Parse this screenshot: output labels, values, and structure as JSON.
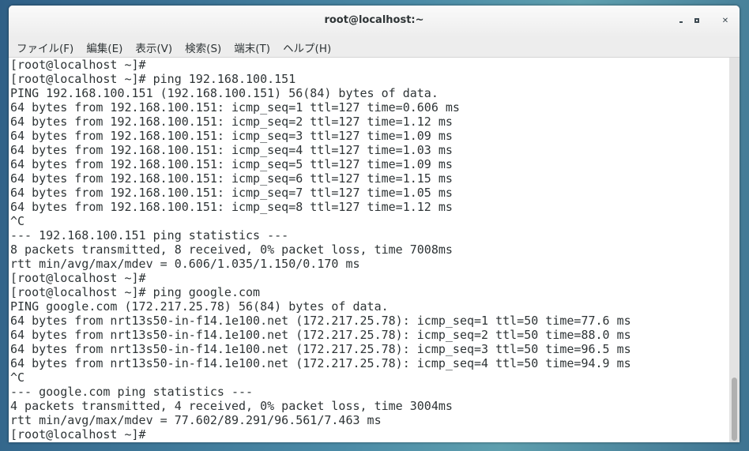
{
  "window": {
    "title": "root@localhost:~"
  },
  "menu": [
    "ファイル(F)",
    "編集(E)",
    "表示(V)",
    "検索(S)",
    "端末(T)",
    "ヘルプ(H)"
  ],
  "terminal_lines": [
    "[root@localhost ~]#",
    "[root@localhost ~]# ping 192.168.100.151",
    "PING 192.168.100.151 (192.168.100.151) 56(84) bytes of data.",
    "64 bytes from 192.168.100.151: icmp_seq=1 ttl=127 time=0.606 ms",
    "64 bytes from 192.168.100.151: icmp_seq=2 ttl=127 time=1.12 ms",
    "64 bytes from 192.168.100.151: icmp_seq=3 ttl=127 time=1.09 ms",
    "64 bytes from 192.168.100.151: icmp_seq=4 ttl=127 time=1.03 ms",
    "64 bytes from 192.168.100.151: icmp_seq=5 ttl=127 time=1.09 ms",
    "64 bytes from 192.168.100.151: icmp_seq=6 ttl=127 time=1.15 ms",
    "64 bytes from 192.168.100.151: icmp_seq=7 ttl=127 time=1.05 ms",
    "64 bytes from 192.168.100.151: icmp_seq=8 ttl=127 time=1.12 ms",
    "^C",
    "--- 192.168.100.151 ping statistics ---",
    "8 packets transmitted, 8 received, 0% packet loss, time 7008ms",
    "rtt min/avg/max/mdev = 0.606/1.035/1.150/0.170 ms",
    "[root@localhost ~]#",
    "[root@localhost ~]# ping google.com",
    "PING google.com (172.217.25.78) 56(84) bytes of data.",
    "64 bytes from nrt13s50-in-f14.1e100.net (172.217.25.78): icmp_seq=1 ttl=50 time=77.6 ms",
    "64 bytes from nrt13s50-in-f14.1e100.net (172.217.25.78): icmp_seq=2 ttl=50 time=88.0 ms",
    "64 bytes from nrt13s50-in-f14.1e100.net (172.217.25.78): icmp_seq=3 ttl=50 time=96.5 ms",
    "64 bytes from nrt13s50-in-f14.1e100.net (172.217.25.78): icmp_seq=4 ttl=50 time=94.9 ms",
    "^C",
    "--- google.com ping statistics ---",
    "4 packets transmitted, 4 received, 0% packet loss, time 3004ms",
    "rtt min/avg/max/mdev = 77.602/89.291/96.561/7.463 ms",
    "[root@localhost ~]#"
  ]
}
